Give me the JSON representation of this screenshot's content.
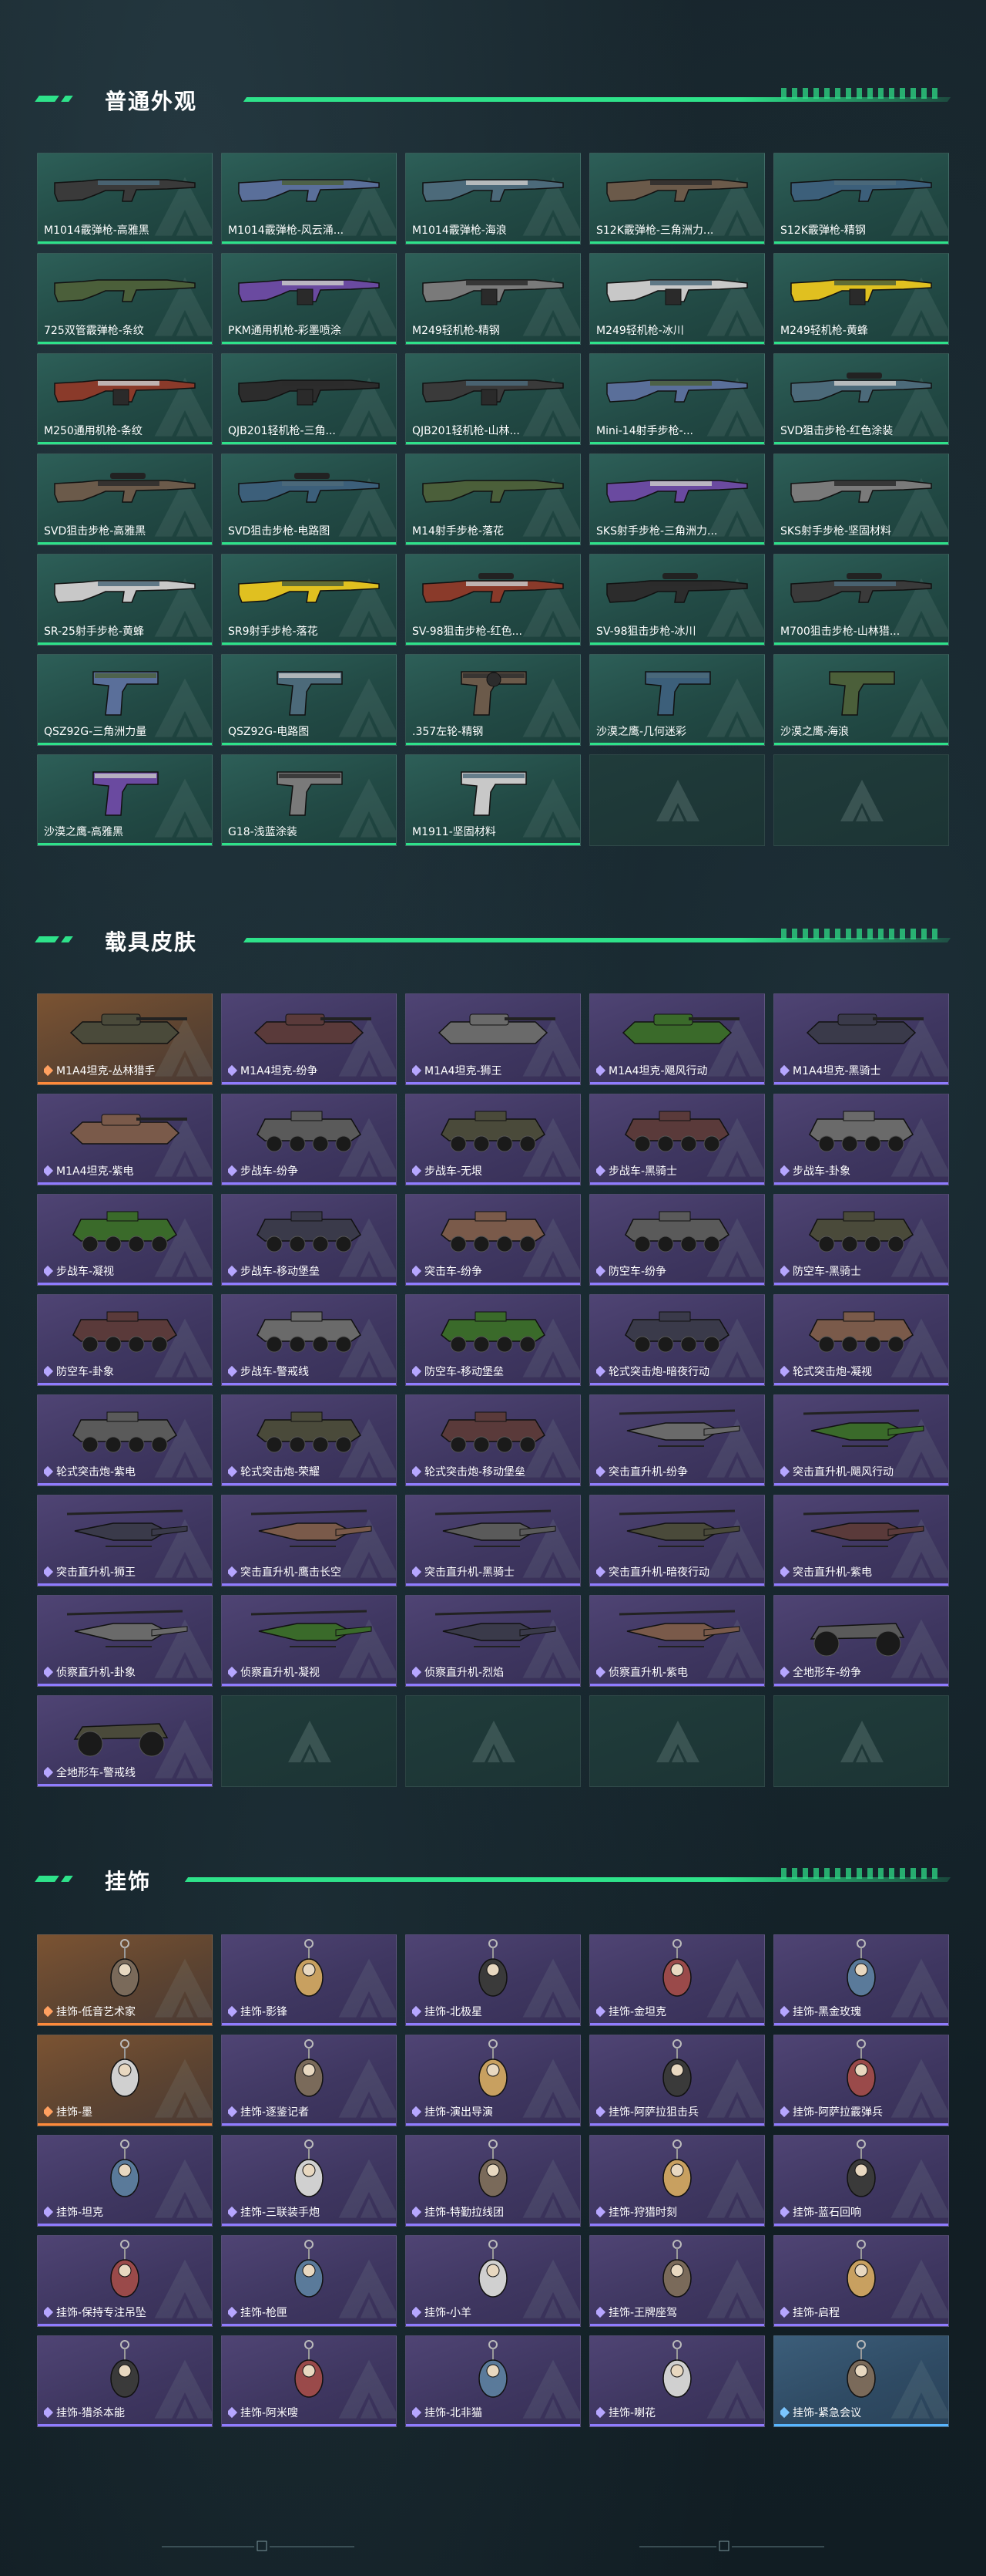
{
  "colors": {
    "accent": "#2ee28a",
    "tile_common": "#2d5f58",
    "tile_rare": "#4f4474",
    "tile_legendary": "#7b5332",
    "tile_blue": "#3c5e7a"
  },
  "sections": {
    "weapons": {
      "title": "普通外观",
      "items": [
        {
          "label": "M1014霰弹枪-高雅黑",
          "rarity": "green",
          "icon": "shotgun-icon"
        },
        {
          "label": "M1014霰弹枪-风云涌...",
          "rarity": "green",
          "icon": "shotgun-icon"
        },
        {
          "label": "M1014霰弹枪-海浪",
          "rarity": "green",
          "icon": "shotgun-icon"
        },
        {
          "label": "S12K霰弹枪-三角洲力...",
          "rarity": "green",
          "icon": "shotgun-icon"
        },
        {
          "label": "S12K霰弹枪-精钢",
          "rarity": "green",
          "icon": "shotgun-icon"
        },
        {
          "label": "725双管霰弹枪-条纹",
          "rarity": "green",
          "icon": "shotgun-icon"
        },
        {
          "label": "PKM通用机枪-彩墨喷涂",
          "rarity": "green",
          "icon": "machine-gun-icon"
        },
        {
          "label": "M249轻机枪-精钢",
          "rarity": "green",
          "icon": "machine-gun-icon"
        },
        {
          "label": "M249轻机枪-冰川",
          "rarity": "green",
          "icon": "machine-gun-icon"
        },
        {
          "label": "M249轻机枪-黄蜂",
          "rarity": "green",
          "icon": "machine-gun-icon"
        },
        {
          "label": "M250通用机枪-条纹",
          "rarity": "green",
          "icon": "machine-gun-icon"
        },
        {
          "label": "QJB201轻机枪-三角...",
          "rarity": "green",
          "icon": "machine-gun-icon"
        },
        {
          "label": "QJB201轻机枪-山林...",
          "rarity": "green",
          "icon": "machine-gun-icon"
        },
        {
          "label": "Mini-14射手步枪-...",
          "rarity": "green",
          "icon": "rifle-icon"
        },
        {
          "label": "SVD狙击步枪-红色涂装",
          "rarity": "green",
          "icon": "sniper-icon"
        },
        {
          "label": "SVD狙击步枪-高雅黑",
          "rarity": "green",
          "icon": "sniper-icon"
        },
        {
          "label": "SVD狙击步枪-电路图",
          "rarity": "green",
          "icon": "sniper-icon"
        },
        {
          "label": "M14射手步枪-落花",
          "rarity": "green",
          "icon": "rifle-icon"
        },
        {
          "label": "SKS射手步枪-三角洲力...",
          "rarity": "green",
          "icon": "rifle-icon"
        },
        {
          "label": "SKS射手步枪-坚固材料",
          "rarity": "green",
          "icon": "rifle-icon"
        },
        {
          "label": "SR-25射手步枪-黄蜂",
          "rarity": "green",
          "icon": "rifle-icon"
        },
        {
          "label": "SR9射手步枪-落花",
          "rarity": "green",
          "icon": "rifle-icon"
        },
        {
          "label": "SV-98狙击步枪-红色...",
          "rarity": "green",
          "icon": "sniper-icon"
        },
        {
          "label": "SV-98狙击步枪-冰川",
          "rarity": "green",
          "icon": "sniper-icon"
        },
        {
          "label": "M700狙击步枪-山林猎...",
          "rarity": "green",
          "icon": "sniper-icon"
        },
        {
          "label": "QSZ92G-三角洲力量",
          "rarity": "green",
          "icon": "pistol-icon"
        },
        {
          "label": "QSZ92G-电路图",
          "rarity": "green",
          "icon": "pistol-icon"
        },
        {
          "label": ".357左轮-精钢",
          "rarity": "green",
          "icon": "revolver-icon"
        },
        {
          "label": "沙漠之鹰-几何迷彩",
          "rarity": "green",
          "icon": "pistol-icon"
        },
        {
          "label": "沙漠之鹰-海浪",
          "rarity": "green",
          "icon": "pistol-icon"
        },
        {
          "label": "沙漠之鹰-高雅黑",
          "rarity": "green",
          "icon": "pistol-icon"
        },
        {
          "label": "G18-浅蓝涂装",
          "rarity": "green",
          "icon": "pistol-icon"
        },
        {
          "label": "M1911-坚固材料",
          "rarity": "green",
          "icon": "pistol-icon"
        },
        {
          "label": "",
          "rarity": "empty",
          "icon": "delta-logo-icon"
        },
        {
          "label": "",
          "rarity": "empty",
          "icon": "delta-logo-icon"
        }
      ]
    },
    "vehicles": {
      "title": "载具皮肤",
      "items": [
        {
          "label": "M1A4坦克-丛林猎手",
          "rarity": "orange",
          "icon": "tank-icon"
        },
        {
          "label": "M1A4坦克-纷争",
          "rarity": "purple",
          "icon": "tank-icon"
        },
        {
          "label": "M1A4坦克-狮王",
          "rarity": "purple",
          "icon": "tank-icon"
        },
        {
          "label": "M1A4坦克-飓风行动",
          "rarity": "purple",
          "icon": "tank-icon"
        },
        {
          "label": "M1A4坦克-黑骑士",
          "rarity": "purple",
          "icon": "tank-icon"
        },
        {
          "label": "M1A4坦克-紫电",
          "rarity": "purple",
          "icon": "tank-icon"
        },
        {
          "label": "步战车-纷争",
          "rarity": "purple",
          "icon": "ifv-icon"
        },
        {
          "label": "步战车-无垠",
          "rarity": "purple",
          "icon": "ifv-icon"
        },
        {
          "label": "步战车-黑骑士",
          "rarity": "purple",
          "icon": "ifv-icon"
        },
        {
          "label": "步战车-卦象",
          "rarity": "purple",
          "icon": "ifv-icon"
        },
        {
          "label": "步战车-凝视",
          "rarity": "purple",
          "icon": "ifv-icon"
        },
        {
          "label": "步战车-移动堡垒",
          "rarity": "purple",
          "icon": "ifv-icon"
        },
        {
          "label": "突击车-纷争",
          "rarity": "purple",
          "icon": "assault-vehicle-icon"
        },
        {
          "label": "防空车-纷争",
          "rarity": "purple",
          "icon": "aa-vehicle-icon"
        },
        {
          "label": "防空车-黑骑士",
          "rarity": "purple",
          "icon": "aa-vehicle-icon"
        },
        {
          "label": "防空车-卦象",
          "rarity": "purple",
          "icon": "aa-vehicle-icon"
        },
        {
          "label": "步战车-警戒线",
          "rarity": "purple",
          "icon": "ifv-icon"
        },
        {
          "label": "防空车-移动堡垒",
          "rarity": "purple",
          "icon": "aa-vehicle-icon"
        },
        {
          "label": "轮式突击炮-暗夜行动",
          "rarity": "purple",
          "icon": "wheeled-gun-icon"
        },
        {
          "label": "轮式突击炮-凝视",
          "rarity": "purple",
          "icon": "wheeled-gun-icon"
        },
        {
          "label": "轮式突击炮-紫电",
          "rarity": "purple",
          "icon": "wheeled-gun-icon"
        },
        {
          "label": "轮式突击炮-荣耀",
          "rarity": "purple",
          "icon": "wheeled-gun-icon"
        },
        {
          "label": "轮式突击炮-移动堡垒",
          "rarity": "purple",
          "icon": "wheeled-gun-icon"
        },
        {
          "label": "突击直升机-纷争",
          "rarity": "purple",
          "icon": "attack-helicopter-icon"
        },
        {
          "label": "突击直升机-飓风行动",
          "rarity": "purple",
          "icon": "attack-helicopter-icon"
        },
        {
          "label": "突击直升机-狮王",
          "rarity": "purple",
          "icon": "attack-helicopter-icon"
        },
        {
          "label": "突击直升机-鹰击长空",
          "rarity": "purple",
          "icon": "attack-helicopter-icon"
        },
        {
          "label": "突击直升机-黑骑士",
          "rarity": "purple",
          "icon": "attack-helicopter-icon"
        },
        {
          "label": "突击直升机-暗夜行动",
          "rarity": "purple",
          "icon": "attack-helicopter-icon"
        },
        {
          "label": "突击直升机-紫电",
          "rarity": "purple",
          "icon": "attack-helicopter-icon"
        },
        {
          "label": "侦察直升机-卦象",
          "rarity": "purple",
          "icon": "scout-helicopter-icon"
        },
        {
          "label": "侦察直升机-凝视",
          "rarity": "purple",
          "icon": "scout-helicopter-icon"
        },
        {
          "label": "侦察直升机-烈焰",
          "rarity": "purple",
          "icon": "scout-helicopter-icon"
        },
        {
          "label": "侦察直升机-紫电",
          "rarity": "purple",
          "icon": "scout-helicopter-icon"
        },
        {
          "label": "全地形车-纷争",
          "rarity": "purple",
          "icon": "atv-icon"
        },
        {
          "label": "全地形车-警戒线",
          "rarity": "purple",
          "icon": "atv-icon"
        },
        {
          "label": "",
          "rarity": "empty",
          "icon": "delta-logo-icon"
        },
        {
          "label": "",
          "rarity": "empty",
          "icon": "delta-logo-icon"
        },
        {
          "label": "",
          "rarity": "empty",
          "icon": "delta-logo-icon"
        },
        {
          "label": "",
          "rarity": "empty",
          "icon": "delta-logo-icon"
        }
      ]
    },
    "charms": {
      "title": "挂饰",
      "items": [
        {
          "label": "挂饰-低音艺术家",
          "rarity": "orange",
          "icon": "charm-icon"
        },
        {
          "label": "挂饰-影锋",
          "rarity": "purple",
          "icon": "charm-icon"
        },
        {
          "label": "挂饰-北极星",
          "rarity": "purple",
          "icon": "charm-icon"
        },
        {
          "label": "挂饰-金坦克",
          "rarity": "purple",
          "icon": "charm-icon"
        },
        {
          "label": "挂饰-黑金玫瑰",
          "rarity": "purple",
          "icon": "charm-icon"
        },
        {
          "label": "挂饰-墨",
          "rarity": "orange",
          "icon": "charm-icon"
        },
        {
          "label": "挂饰-逐鉴记者",
          "rarity": "purple",
          "icon": "charm-icon"
        },
        {
          "label": "挂饰-演出导演",
          "rarity": "purple",
          "icon": "charm-icon"
        },
        {
          "label": "挂饰-阿萨拉狙击兵",
          "rarity": "purple",
          "icon": "charm-icon"
        },
        {
          "label": "挂饰-阿萨拉霰弹兵",
          "rarity": "purple",
          "icon": "charm-icon"
        },
        {
          "label": "挂饰-坦克",
          "rarity": "purple",
          "icon": "charm-icon"
        },
        {
          "label": "挂饰-三联装手炮",
          "rarity": "purple",
          "icon": "charm-icon"
        },
        {
          "label": "挂饰-特勤拉线团",
          "rarity": "purple",
          "icon": "charm-icon"
        },
        {
          "label": "挂饰-狩猎时刻",
          "rarity": "purple",
          "icon": "charm-icon"
        },
        {
          "label": "挂饰-蓝石回响",
          "rarity": "purple",
          "icon": "charm-icon"
        },
        {
          "label": "挂饰-保持专注吊坠",
          "rarity": "purple",
          "icon": "charm-icon"
        },
        {
          "label": "挂饰-枪匣",
          "rarity": "purple",
          "icon": "charm-icon"
        },
        {
          "label": "挂饰-小羊",
          "rarity": "purple",
          "icon": "charm-icon"
        },
        {
          "label": "挂饰-王牌座驾",
          "rarity": "purple",
          "icon": "charm-icon"
        },
        {
          "label": "挂饰-启程",
          "rarity": "purple",
          "icon": "charm-icon"
        },
        {
          "label": "挂饰-猎杀本能",
          "rarity": "purple",
          "icon": "charm-icon"
        },
        {
          "label": "挂饰-阿米嗖",
          "rarity": "purple",
          "icon": "charm-icon"
        },
        {
          "label": "挂饰-北非猫",
          "rarity": "purple",
          "icon": "charm-icon"
        },
        {
          "label": "挂饰-喇花",
          "rarity": "purple",
          "icon": "charm-icon"
        },
        {
          "label": "挂饰-紧急会议",
          "rarity": "blue",
          "icon": "charm-icon"
        }
      ]
    }
  }
}
